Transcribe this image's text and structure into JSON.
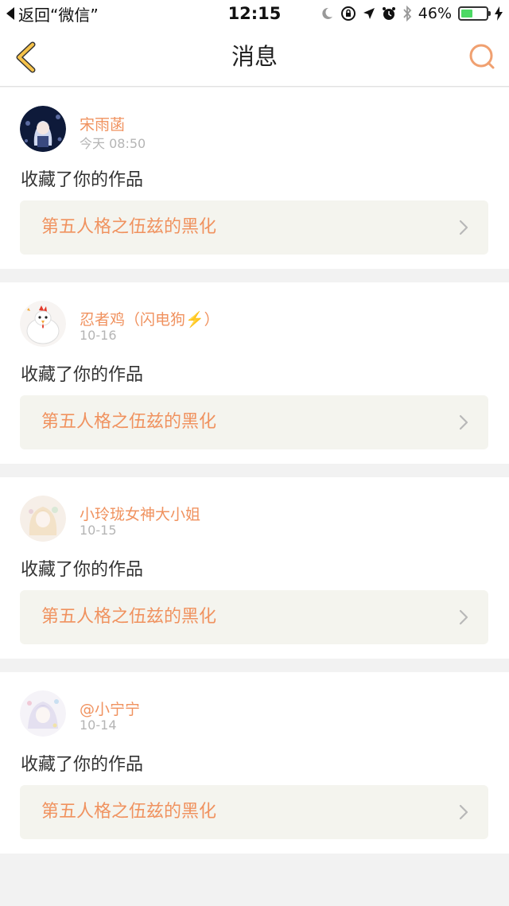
{
  "status_bar": {
    "back_app_label": "返回“微信”",
    "time": "12:15",
    "battery_percent_label": "46%",
    "battery_level": 0.46,
    "icons": [
      "moon-icon",
      "rotation-lock-icon",
      "location-icon",
      "alarm-icon",
      "bluetooth-icon",
      "battery-icon",
      "charging-icon"
    ]
  },
  "nav": {
    "title": "消息",
    "back_icon": "chevron-left-icon",
    "search_icon": "search-icon"
  },
  "colors": {
    "accent": "#f0925f",
    "back_arrow": "#f5c24a",
    "card_link_bg": "#f4f4ee"
  },
  "notifications": [
    {
      "user": "宋雨菡",
      "time": "今天 08:50",
      "action": "收藏了你的作品",
      "work_title": "第五人格之伍兹的黑化",
      "avatar": "anime-girl-dark-avatar"
    },
    {
      "user": "忍者鸡（闪电狗⚡️）",
      "time": "10-16",
      "action": "收藏了你的作品",
      "work_title": "第五人格之伍兹的黑化",
      "avatar": "chicken-avatar"
    },
    {
      "user": "小玲珑女神大小姐",
      "time": "10-15",
      "action": "收藏了你的作品",
      "work_title": "第五人格之伍兹的黑化",
      "avatar": "anime-girl-light-avatar"
    },
    {
      "user": "@小宁宁",
      "time": "10-14",
      "action": "收藏了你的作品",
      "work_title": "第五人格之伍兹的黑化",
      "avatar": "anime-girl-pastel-avatar"
    }
  ]
}
